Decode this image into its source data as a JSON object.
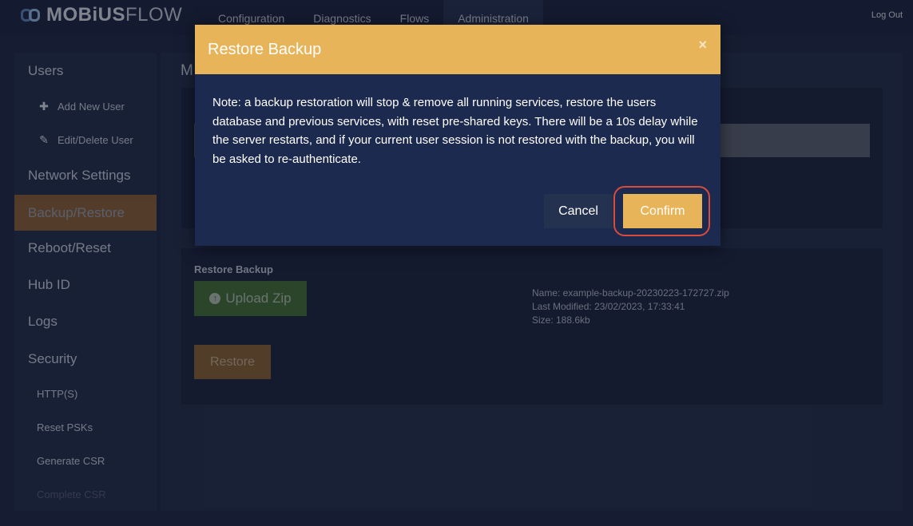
{
  "brand": {
    "bold": "MOBiUS",
    "light": "FLOW"
  },
  "nav": {
    "tabs": [
      "Configuration",
      "Diagnostics",
      "Flows",
      "Administration"
    ],
    "active_tab": "Administration",
    "logout_label": "Log Out"
  },
  "sidebar": {
    "users": "Users",
    "add_new_user": "Add New User",
    "edit_delete_user": "Edit/Delete User",
    "network_settings": "Network Settings",
    "backup_restore": "Backup/Restore",
    "reboot_reset": "Reboot/Reset",
    "hub_id": "Hub ID",
    "logs": "Logs",
    "security": "Security",
    "https": "HTTP(S)",
    "reset_psks": "Reset PSKs",
    "generate_csr": "Generate CSR",
    "complete_csr": "Complete CSR",
    "active_item": "Backup/Restore"
  },
  "main": {
    "title_fragment": "M",
    "restore_section": {
      "heading": "Restore Backup",
      "upload_label": "Upload Zip",
      "restore_label": "Restore",
      "file_name": "Name: example-backup-20230223-172727.zip",
      "last_modified": "Last Modified: 23/02/2023, 17:33:41",
      "size": "Size: 188.6kb"
    }
  },
  "modal": {
    "title": "Restore Backup",
    "close_glyph": "×",
    "body": "Note: a backup restoration will stop & remove all running services, restore the users database and previous services, with reset pre-shared keys. There will be a 10s delay while the server restarts, and if your current user session is not restored with the backup, you will be asked to re-authenticate.",
    "cancel_label": "Cancel",
    "confirm_label": "Confirm"
  },
  "colors": {
    "accent": "#e8b459",
    "active_sidebar": "#e88d28",
    "upload_green": "#46733a",
    "highlight_ring": "#d94b3b",
    "background": "#1f2a45"
  },
  "icons": {
    "plus": "plus-icon",
    "pencil": "pencil-icon",
    "upload": "upload-circle-icon",
    "close": "close-icon"
  }
}
